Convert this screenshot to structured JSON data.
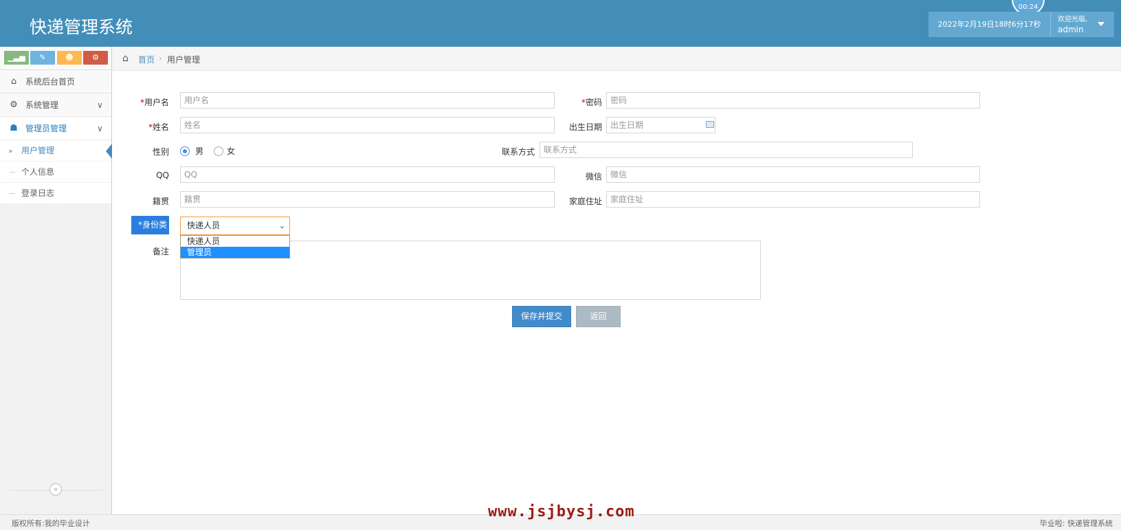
{
  "header": {
    "title": "快递管理系统",
    "datetime": "2022年2月19日18时6分17秒",
    "welcome": "欢迎光临,",
    "username": "admin",
    "bubble_text": "00:24"
  },
  "sidebar": {
    "menu": [
      {
        "label": "系统后台首页",
        "icon": "home-icon"
      },
      {
        "label": "系统管理",
        "icon": "cogs-icon"
      },
      {
        "label": "管理员管理",
        "icon": "users-icon"
      }
    ],
    "submenu": [
      {
        "label": "用户管理",
        "active": true
      },
      {
        "label": "个人信息"
      },
      {
        "label": "登录日志"
      }
    ]
  },
  "breadcrumb": {
    "home": "首页",
    "current": "用户管理"
  },
  "form": {
    "username_label": "用户名",
    "username_placeholder": "用户名",
    "password_label": "密码",
    "password_placeholder": "密码",
    "name_label": "姓名",
    "name_placeholder": "姓名",
    "birth_label": "出生日期",
    "birth_placeholder": "出生日期",
    "gender_label": "性别",
    "gender_male": "男",
    "gender_female": "女",
    "contact_label": "联系方式",
    "contact_placeholder": "联系方式",
    "qq_label": "QQ",
    "qq_placeholder": "QQ",
    "wechat_label": "微信",
    "wechat_placeholder": "微信",
    "native_label": "籍贯",
    "native_placeholder": "籍贯",
    "address_label": "家庭住址",
    "address_placeholder": "家庭住址",
    "idtype_label": "身份类型",
    "idtype_value": "快递人员",
    "idtype_options": [
      "快递人员",
      "管理员"
    ],
    "remark_label": "备注",
    "required_mark": "*",
    "save_button": "保存并提交",
    "back_button": "返回"
  },
  "footer": {
    "copyright": "版权所有:我的毕业设计",
    "right_text": "毕业啦: 快递管理系统",
    "watermark": "www.jsjbysj.com"
  }
}
